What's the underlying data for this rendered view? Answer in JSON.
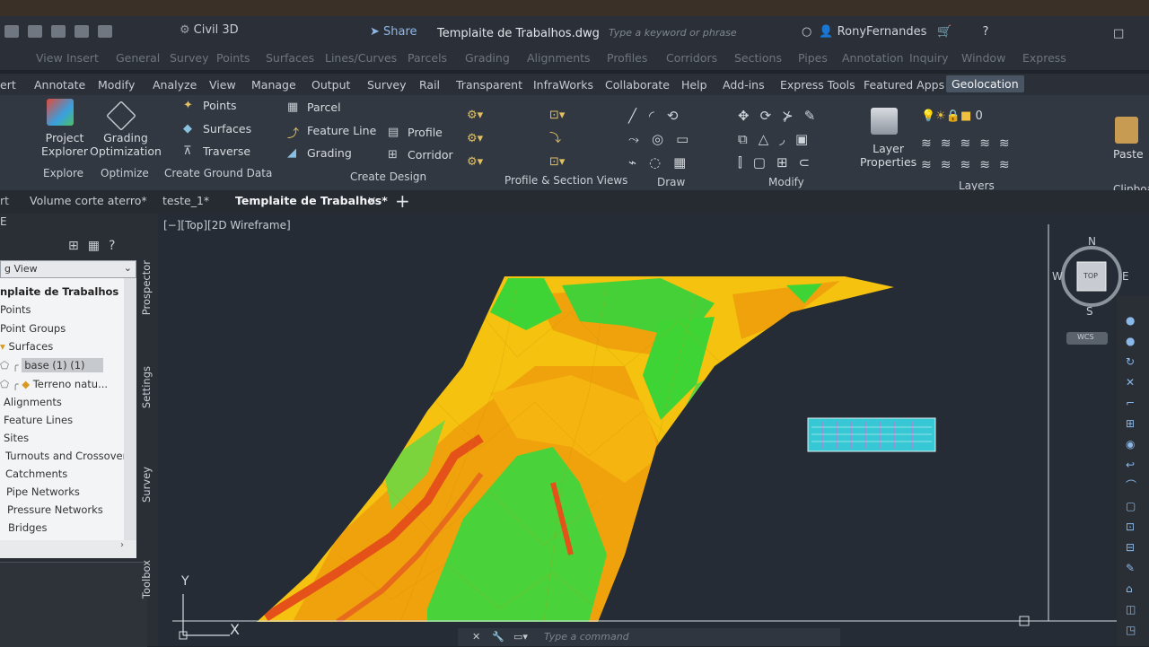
{
  "title_bar": {
    "workspace": "Civil 3D",
    "share_label": "Share",
    "document_title": "Templaite de Trabalhos.dwg",
    "search_placeholder": "Type a keyword or phrase",
    "user_name": "RonyFernandes"
  },
  "menu_row_1": [
    "ert",
    "Annotate",
    "Modify",
    "Analyze",
    "View",
    "Manage",
    "Output",
    "Survey",
    "Rail",
    "Transparent",
    "InfraWorks",
    "Collaborate",
    "Help",
    "Add-ins",
    "Express Tools",
    "Featured Apps",
    "Geolocation"
  ],
  "menu_row_2": [
    "ert",
    "Annotate",
    "Modify",
    "Analyze",
    "View",
    "Manage",
    "Output",
    "Survey",
    "Rail",
    "Transparent",
    "InfraWorks",
    "Collaborate",
    "Help",
    "Add-ins",
    "Express Tools",
    "Featured Apps",
    "Geolocation"
  ],
  "menu_row_faded": [
    "View",
    "Insert",
    "General",
    "Survey",
    "Points",
    "Surfaces",
    "Lines/Curves",
    "Parcels",
    "Grading",
    "Alignments",
    "Profiles",
    "Corridors",
    "Sections",
    "Pipes",
    "Annotation",
    "Inquiry",
    "Window",
    "Express"
  ],
  "ribbon": {
    "project_explorer": "Project\nExplorer",
    "grading_optimization": "Grading\nOptimization",
    "points": "Points",
    "surfaces": "Surfaces",
    "traverse": "Traverse",
    "parcel": "Parcel",
    "feature_line": "Feature Line",
    "grading": "Grading",
    "profile": "Profile",
    "corridor": "Corridor",
    "layer_properties": "Layer\nProperties",
    "paste": "Paste",
    "layer_count": "0",
    "panels": {
      "explore": "Explore",
      "optimize": "Optimize",
      "create_ground_data": "Create Ground Data",
      "create_design": "Create Design",
      "profile_section_views": "Profile & Section Views",
      "draw": "Draw",
      "modify": "Modify",
      "layers": "Layers",
      "clipboard": "Clipboa"
    }
  },
  "doc_tabs": [
    "rt",
    "Volume corte aterro*",
    "teste_1*",
    "Templaite de Trabalhos*"
  ],
  "viewport": {
    "label": "[−][Top][2D Wireframe]",
    "compass": {
      "n": "N",
      "s": "S",
      "e": "E",
      "w": "W",
      "cube": "TOP",
      "wcs": "WCS"
    },
    "ucs": {
      "y": "Y",
      "x": "X"
    }
  },
  "toolspace": {
    "dropdown": "g View",
    "vertical_tabs": [
      "Prospector",
      "Settings",
      "Survey",
      "Toolbox"
    ],
    "tree": [
      "nplaite de Trabalhos",
      "Points",
      "Point Groups",
      "Surfaces",
      "base (1) (1)",
      "Terreno natu...",
      "Alignments",
      "Feature Lines",
      "Sites",
      "Turnouts and Crossovers",
      "Catchments",
      "Pipe Networks",
      "Pressure Networks",
      "Bridges"
    ]
  },
  "command_line": {
    "placeholder": "Type a command"
  },
  "colors": {
    "surface_green": "#3fd435",
    "surface_orange": "#f0a20c",
    "surface_yellow": "#f4c20f",
    "surface_red": "#e4521a",
    "accent": "#4a5563"
  }
}
